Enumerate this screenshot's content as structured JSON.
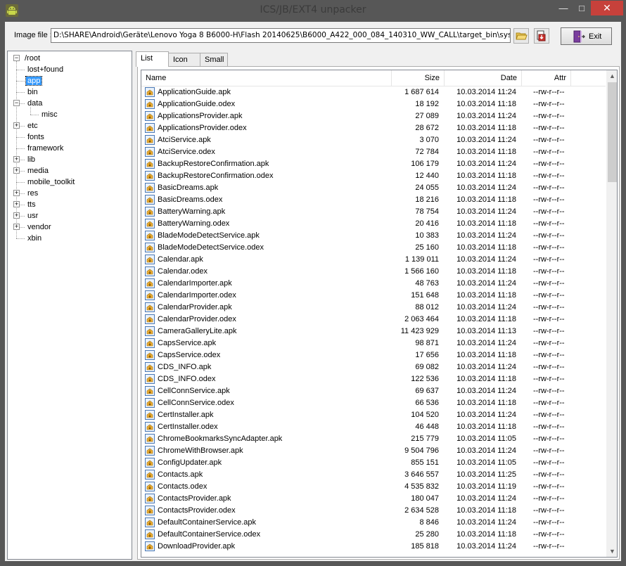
{
  "window": {
    "title": "ICS/JB/EXT4 unpacker",
    "min_glyph": "—",
    "max_glyph": "□",
    "close_glyph": "✕"
  },
  "toolbar": {
    "image_file_label": "Image file :",
    "image_path": "D:\\SHARE\\Android\\Geräte\\Lenovo Yoga 8 B6000-H\\Flash 20140625\\B6000_A422_000_084_140310_WW_CALL\\target_bin\\system.img",
    "exit_label": "Exit"
  },
  "tree": {
    "root": "/root",
    "items": [
      {
        "label": "lost+found",
        "expandable": false,
        "level": 1
      },
      {
        "label": "app",
        "expandable": false,
        "level": 1,
        "selected": true
      },
      {
        "label": "bin",
        "expandable": false,
        "level": 1
      },
      {
        "label": "data",
        "expandable": true,
        "expanded": true,
        "level": 1
      },
      {
        "label": "misc",
        "expandable": false,
        "level": 2
      },
      {
        "label": "etc",
        "expandable": true,
        "level": 1
      },
      {
        "label": "fonts",
        "expandable": false,
        "level": 1
      },
      {
        "label": "framework",
        "expandable": false,
        "level": 1
      },
      {
        "label": "lib",
        "expandable": true,
        "level": 1
      },
      {
        "label": "media",
        "expandable": true,
        "level": 1
      },
      {
        "label": "mobile_toolkit",
        "expandable": false,
        "level": 1
      },
      {
        "label": "res",
        "expandable": true,
        "level": 1
      },
      {
        "label": "tts",
        "expandable": true,
        "level": 1
      },
      {
        "label": "usr",
        "expandable": true,
        "level": 1
      },
      {
        "label": "vendor",
        "expandable": true,
        "level": 1
      },
      {
        "label": "xbin",
        "expandable": false,
        "level": 1
      }
    ]
  },
  "tabs": [
    {
      "label": "List",
      "active": true
    },
    {
      "label": "Icon",
      "active": false
    },
    {
      "label": "Small",
      "active": false
    }
  ],
  "list": {
    "columns": {
      "name": "Name",
      "size": "Size",
      "date": "Date",
      "attr": "Attr"
    },
    "rows": [
      [
        "ApplicationGuide.apk",
        "1 687 614",
        "10.03.2014 11:24",
        "--rw-r--r--"
      ],
      [
        "ApplicationGuide.odex",
        "18 192",
        "10.03.2014 11:18",
        "--rw-r--r--"
      ],
      [
        "ApplicationsProvider.apk",
        "27 089",
        "10.03.2014 11:24",
        "--rw-r--r--"
      ],
      [
        "ApplicationsProvider.odex",
        "28 672",
        "10.03.2014 11:18",
        "--rw-r--r--"
      ],
      [
        "AtciService.apk",
        "3 070",
        "10.03.2014 11:24",
        "--rw-r--r--"
      ],
      [
        "AtciService.odex",
        "72 784",
        "10.03.2014 11:18",
        "--rw-r--r--"
      ],
      [
        "BackupRestoreConfirmation.apk",
        "106 179",
        "10.03.2014 11:24",
        "--rw-r--r--"
      ],
      [
        "BackupRestoreConfirmation.odex",
        "12 440",
        "10.03.2014 11:18",
        "--rw-r--r--"
      ],
      [
        "BasicDreams.apk",
        "24 055",
        "10.03.2014 11:24",
        "--rw-r--r--"
      ],
      [
        "BasicDreams.odex",
        "18 216",
        "10.03.2014 11:18",
        "--rw-r--r--"
      ],
      [
        "BatteryWarning.apk",
        "78 754",
        "10.03.2014 11:24",
        "--rw-r--r--"
      ],
      [
        "BatteryWarning.odex",
        "20 416",
        "10.03.2014 11:18",
        "--rw-r--r--"
      ],
      [
        "BladeModeDetectService.apk",
        "10 383",
        "10.03.2014 11:24",
        "--rw-r--r--"
      ],
      [
        "BladeModeDetectService.odex",
        "25 160",
        "10.03.2014 11:18",
        "--rw-r--r--"
      ],
      [
        "Calendar.apk",
        "1 139 011",
        "10.03.2014 11:24",
        "--rw-r--r--"
      ],
      [
        "Calendar.odex",
        "1 566 160",
        "10.03.2014 11:18",
        "--rw-r--r--"
      ],
      [
        "CalendarImporter.apk",
        "48 763",
        "10.03.2014 11:24",
        "--rw-r--r--"
      ],
      [
        "CalendarImporter.odex",
        "151 648",
        "10.03.2014 11:18",
        "--rw-r--r--"
      ],
      [
        "CalendarProvider.apk",
        "88 012",
        "10.03.2014 11:24",
        "--rw-r--r--"
      ],
      [
        "CalendarProvider.odex",
        "2 063 464",
        "10.03.2014 11:18",
        "--rw-r--r--"
      ],
      [
        "CameraGalleryLite.apk",
        "11 423 929",
        "10.03.2014 11:13",
        "--rw-r--r--"
      ],
      [
        "CapsService.apk",
        "98 871",
        "10.03.2014 11:24",
        "--rw-r--r--"
      ],
      [
        "CapsService.odex",
        "17 656",
        "10.03.2014 11:18",
        "--rw-r--r--"
      ],
      [
        "CDS_INFO.apk",
        "69 082",
        "10.03.2014 11:24",
        "--rw-r--r--"
      ],
      [
        "CDS_INFO.odex",
        "122 536",
        "10.03.2014 11:18",
        "--rw-r--r--"
      ],
      [
        "CellConnService.apk",
        "69 637",
        "10.03.2014 11:24",
        "--rw-r--r--"
      ],
      [
        "CellConnService.odex",
        "66 536",
        "10.03.2014 11:18",
        "--rw-r--r--"
      ],
      [
        "CertInstaller.apk",
        "104 520",
        "10.03.2014 11:24",
        "--rw-r--r--"
      ],
      [
        "CertInstaller.odex",
        "46 448",
        "10.03.2014 11:18",
        "--rw-r--r--"
      ],
      [
        "ChromeBookmarksSyncAdapter.apk",
        "215 779",
        "10.03.2014 11:05",
        "--rw-r--r--"
      ],
      [
        "ChromeWithBrowser.apk",
        "9 504 796",
        "10.03.2014 11:24",
        "--rw-r--r--"
      ],
      [
        "ConfigUpdater.apk",
        "855 151",
        "10.03.2014 11:05",
        "--rw-r--r--"
      ],
      [
        "Contacts.apk",
        "3 646 557",
        "10.03.2014 11:25",
        "--rw-r--r--"
      ],
      [
        "Contacts.odex",
        "4 535 832",
        "10.03.2014 11:19",
        "--rw-r--r--"
      ],
      [
        "ContactsProvider.apk",
        "180 047",
        "10.03.2014 11:24",
        "--rw-r--r--"
      ],
      [
        "ContactsProvider.odex",
        "2 634 528",
        "10.03.2014 11:18",
        "--rw-r--r--"
      ],
      [
        "DefaultContainerService.apk",
        "8 846",
        "10.03.2014 11:24",
        "--rw-r--r--"
      ],
      [
        "DefaultContainerService.odex",
        "25 280",
        "10.03.2014 11:18",
        "--rw-r--r--"
      ],
      [
        "DownloadProvider.apk",
        "185 818",
        "10.03.2014 11:24",
        "--rw-r--r--"
      ]
    ]
  },
  "icons": {
    "app": "android-icon",
    "open": "folder-open-icon",
    "extract": "extract-icon",
    "exit": "exit-door-icon",
    "file": "package-file-icon"
  }
}
